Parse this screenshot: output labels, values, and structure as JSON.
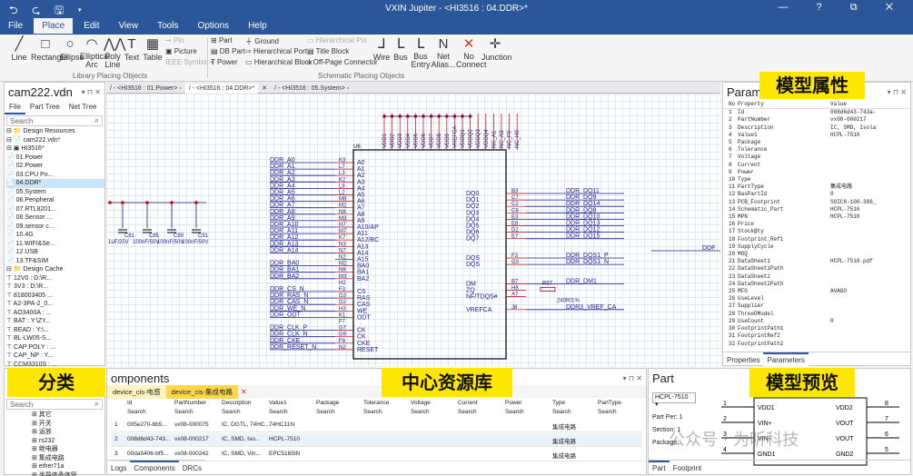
{
  "app": {
    "title": "VXIN Jupiter - <HI3516 : 04.DDR>*",
    "quick_access": "⮌ ⮎ 🖫 ▾",
    "window_controls": "— ? ⧉ ✕"
  },
  "menu": [
    "File",
    "Place",
    "Edit",
    "View",
    "Tools",
    "Options",
    "Help"
  ],
  "ribbon": {
    "library_tools": [
      "Line",
      "Rectangle",
      "Ellipse",
      "Elliptical\nArc",
      "Poly\nLine",
      "Text",
      "Table"
    ],
    "library_small": [
      "Pin",
      "Picture",
      "IEEE Symbol ▾"
    ],
    "library_group": "Library Placing Objects",
    "sch_small_1": [
      "Part",
      "DB Part",
      "Power"
    ],
    "sch_small_2": [
      "Ground",
      "Hierarchical Port",
      "Hierarchical Block"
    ],
    "sch_small_3": [
      "Hierarchical Pin",
      "Title Block",
      "Off-Page Connector"
    ],
    "sch_tools": [
      "Wire",
      "Bus",
      "Bus\nEntry",
      "Net\nAlias...",
      "No\nConnect",
      "Junction"
    ],
    "sch_group": "Schematic Placing Objects"
  },
  "project_panel": {
    "title": "cam222.vdn",
    "tabs": [
      "File",
      "Part Tree",
      "Net Tree"
    ],
    "search": "Search",
    "tree": [
      "⊟ 📁 Design Resources",
      "   ⊟ 📄 cam222.vdn*",
      "      ⊟ ▣ HI3516*",
      "         📄 01.Power",
      "         📄 02.Power",
      "         📄 03.CPU Po...",
      "         📄 04.DDR*",
      "         📄 05.System",
      "         📄 06.Peripheral",
      "         📄 07.RTL8201...",
      "         📄 08.Sensor ...",
      "         📄 09.sensor c...",
      "         📄 10.4G",
      "         📄 11.WIFI&Se...",
      "         📄 12.USB",
      "         📄 13.TF&SIM",
      "   ⊟ 📁 Design Cache",
      "      ⊤ 12V0 : D:\\R...",
      "      ⊤ 3V3 : D:\\R...",
      "      ⊤ 818003405 ...",
      "      ⊤ A2-3PA-2_0...",
      "      ⊤ AO3400A : ...",
      "      ⊤ BAT : Y:\\ZY...",
      "      ⊤ BEAD : Y:\\...",
      "      ⊤ BL-LW05-S...",
      "      ⊤ CAP:POLY : ...",
      "      ⊤ CAP_NP : Y...",
      "      ⊤ CCM3310S : ...",
      "      ⊤ CON4 : Y:\\...",
      "      ⊤ CRYSTAL-R..."
    ],
    "selected_index": 6
  },
  "doc_tabs": [
    "/ - <HI3516 : 01.Power> ▫",
    "/ - <HI3516 : 04.DDR>*",
    "✕",
    "/ - <HI3516 : 05.System> ▫"
  ],
  "schematic": {
    "ref": "U6",
    "left_nets": [
      "DDR_A0",
      "DDR_A1",
      "DDR_A2",
      "DDR_A3",
      "DDR_A4",
      "DDR_A5",
      "DDR_A6",
      "DDR_A7",
      "DDR_A8",
      "DDR_A9",
      "DDR_A10",
      "DDR_A11",
      "DDR_A12",
      "DDR_A13",
      "DDR_A14",
      "",
      "DDR_BA0",
      "DDR_BA1",
      "DDR_BA2",
      "",
      "DDR_CS_N",
      "DDR_RAS_N",
      "DDR_CAS_N",
      "DDR_WE_N",
      "DDR_ODT",
      "",
      "DDR_CLK_P",
      "DDR_CLK_N",
      "DDR_CKE",
      "DDR_RESET_N"
    ],
    "left_pinnums": [
      "K3",
      "L7",
      "L3",
      "K2",
      "L8",
      "L2",
      "M8",
      "M2",
      "N8",
      "M3",
      "H7",
      "M7",
      "K7",
      "N3",
      "N7",
      "N2",
      "M2",
      "N8",
      "M3",
      "H2",
      "F3",
      "G3",
      "G2",
      "H3",
      "K1",
      "F7",
      "G7",
      "G9",
      "F9",
      "N2"
    ],
    "left_pins": [
      "A0",
      "A1",
      "A2",
      "A3",
      "A4",
      "A5",
      "A6",
      "A7",
      "A8",
      "A9",
      "A10/AP",
      "A11",
      "A12/BC",
      "A13",
      "A14",
      "A15",
      "BA0",
      "BA1",
      "BA2",
      "",
      "CS",
      "RAS",
      "CAS",
      "WE",
      "ODT",
      "",
      "CK",
      "CK",
      "CKE",
      "RESET"
    ],
    "top_pins": [
      "VDD1",
      "VDD2",
      "VDD3",
      "VDD4",
      "VDD5",
      "VDD6",
      "VDD7",
      "VDD8",
      "VDD9",
      "VREFCA",
      "VDDQ1",
      "VDDQ2",
      "VDDQ3",
      "VDDQ4",
      "NC_A1",
      "NC_A3",
      "NC_F9",
      "NC_H9"
    ],
    "right_pins": [
      "DQ0",
      "DQ1",
      "DQ2",
      "DQ3",
      "DQ4",
      "DQ5",
      "DQ6",
      "DQ7",
      "",
      "",
      "DQS",
      "DQS",
      "",
      "",
      "DM",
      "ZQ",
      "NF/TDQS#",
      "",
      "VREFCA"
    ],
    "right_pinnums": [
      "B3",
      "C7",
      "C2",
      "C8",
      "E3",
      "E8",
      "D2",
      "E7",
      "",
      "",
      "F3",
      "G3",
      "",
      "",
      "B7",
      "H8",
      "A7",
      "",
      "J8"
    ],
    "right_nets": [
      "DDR_DQ11",
      "DDR_DQ9",
      "DDR_DQ14",
      "DDR_DQ8",
      "DDR_DQ10",
      "DDR_DQ13",
      "DDR_DQ12",
      "DDR_DQ15",
      "",
      "",
      "DDR_DQS1_P",
      "DDR_DQS1_N",
      "",
      "",
      "DDR_DM1",
      "",
      "",
      "",
      ""
    ],
    "caps": [
      {
        "ref": "C81",
        "val": "1uF/25V"
      },
      {
        "ref": "C85",
        "val": "100nF/50V"
      },
      {
        "ref": "C89",
        "val": "100nF/50V"
      },
      {
        "ref": "C91",
        "val": "100nF/50V"
      }
    ],
    "resistor": {
      "ref": "R57",
      "val": "240R/1%"
    },
    "vref_net": "DDR3_VREF_CA",
    "far_right_net": "DDF"
  },
  "properties_panel": {
    "title": "Parame",
    "columns": [
      "No",
      "Property",
      "Value"
    ],
    "rows": [
      [
        "1",
        "Id",
        "008d6d43-743a-"
      ],
      [
        "2",
        "PartNumber",
        "vx08-000217"
      ],
      [
        "3",
        "Description",
        "IC, SMD, Isola"
      ],
      [
        "4",
        "Value1",
        "HCPL-7510"
      ],
      [
        "5",
        "Package",
        ""
      ],
      [
        "6",
        "Tolerance",
        ""
      ],
      [
        "7",
        "Voltage",
        ""
      ],
      [
        "8",
        "Current",
        ""
      ],
      [
        "9",
        "Power",
        ""
      ],
      [
        "10",
        "Type",
        ""
      ],
      [
        "11",
        "PartType",
        "集成电路"
      ],
      [
        "12",
        "BasPartId",
        "0"
      ],
      [
        "13",
        "PCB_Footprint",
        "SOIC8-100-386_"
      ],
      [
        "14",
        "Schematic_Part",
        "HCPL-7510"
      ],
      [
        "15",
        "MPN",
        "HCPL-7510"
      ],
      [
        "16",
        "Price",
        ""
      ],
      [
        "17",
        "Stock@ty",
        ""
      ],
      [
        "18",
        "Footprint_Ref1",
        ""
      ],
      [
        "19",
        "SupplyCycle",
        ""
      ],
      [
        "20",
        "MOQ",
        ""
      ],
      [
        "21",
        "DataSheet1",
        "HCPL-7510.pdf"
      ],
      [
        "22",
        "DataSheet1Path",
        ""
      ],
      [
        "23",
        "DataSheet2",
        ""
      ],
      [
        "24",
        "DataSheet2Path",
        ""
      ],
      [
        "25",
        "MFG",
        "AVAGO"
      ],
      [
        "26",
        "UseLevel",
        ""
      ],
      [
        "27",
        "Supplier",
        ""
      ],
      [
        "28",
        "ThreeDModel",
        ""
      ],
      [
        "29",
        "UseCount",
        "0"
      ],
      [
        "30",
        "FootprintPath1",
        ""
      ],
      [
        "31",
        "FootprintRef2",
        ""
      ],
      [
        "32",
        "FootprintPath2",
        ""
      ]
    ],
    "tabs": [
      "Properties",
      "Parameters"
    ]
  },
  "category_panel": {
    "search": "Search",
    "items": [
      "其它",
      "开关",
      "运放",
      "rs232",
      "继电器",
      "集成电路",
      "ether71a",
      "半导体晶体管"
    ]
  },
  "components_panel": {
    "title": "omponents",
    "tabs": [
      "device_cis-电感",
      "device_cis-集成电路"
    ],
    "columns": [
      "Id",
      "PartNumber",
      "Description",
      "Value1",
      "Package",
      "Tolerance",
      "Voltage",
      "Current",
      "Power",
      "Type",
      "PartType"
    ],
    "search_label": "Search",
    "rows": [
      [
        "1",
        "005e270-8b5...",
        "vx08-000075",
        "IC, DGTL, 74HC...",
        "74HC11N",
        "",
        "",
        "",
        "",
        "",
        "集成电路"
      ],
      [
        "2",
        "008d6d43-743...",
        "vx08-000217",
        "IC, SMD, Iso...",
        "HCPL-7510",
        "",
        "",
        "",
        "",
        "",
        "集成电路"
      ],
      [
        "3",
        "00da5406-bf5...",
        "vx08-000242",
        "IC, SMD, Vin...",
        "EPC5165IN",
        "",
        "",
        "",
        "",
        "",
        "集成电路"
      ]
    ],
    "bottom_tabs": [
      "Logs",
      "Components",
      "DRCs"
    ]
  },
  "part_panel": {
    "title": "Part",
    "part_select": "HCPL-7510",
    "part_per_label": "Part Per:",
    "part_per_value": "1",
    "section_label": "Section:",
    "section_value": "1",
    "package_label": "Package:",
    "bottom_tabs": [
      "Part",
      "Footprint"
    ],
    "pins_left": [
      {
        "num": "1",
        "name": "VDD1"
      },
      {
        "num": "2",
        "name": "VIN+"
      },
      {
        "num": "3",
        "name": "VIN-"
      },
      {
        "num": "4",
        "name": "GND1"
      }
    ],
    "pins_right": [
      {
        "num": "8",
        "name": "VDD2"
      },
      {
        "num": "7",
        "name": "VOUT"
      },
      {
        "num": "6",
        "name": "VOUT"
      },
      {
        "num": "5",
        "name": "GND2"
      }
    ]
  },
  "callouts": {
    "model_attr": "模型属性",
    "category": "分类",
    "central_lib": "中心资源库",
    "model_preview": "模型预览"
  },
  "watermark": "公众号 · 为昕科技"
}
